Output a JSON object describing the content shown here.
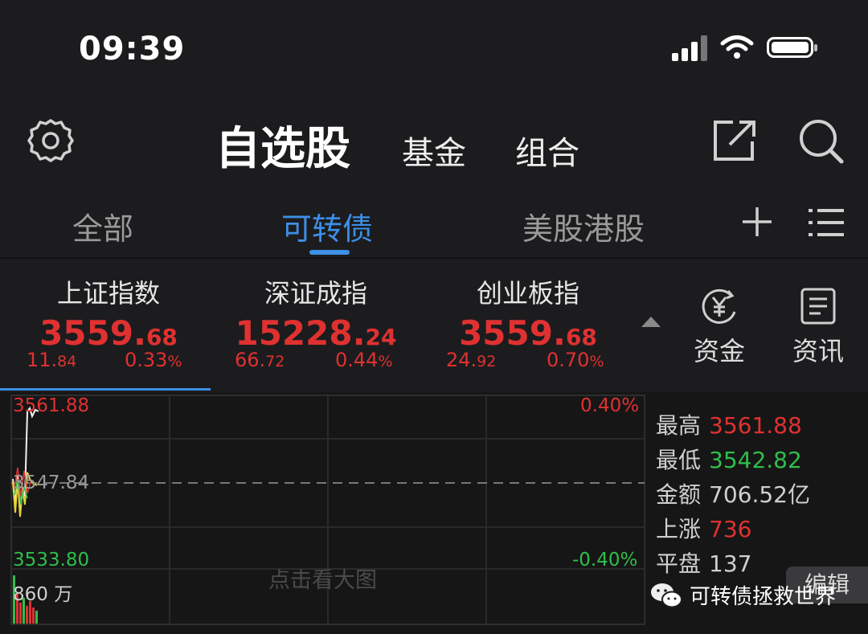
{
  "status_bar": {
    "time": "09:39"
  },
  "header": {
    "title": "自选股",
    "tabs": [
      "基金",
      "组合"
    ]
  },
  "subtabs": {
    "items": [
      "全部",
      "可转债",
      "美股港股"
    ],
    "active_index": 1
  },
  "indices": [
    {
      "name": "上证指数",
      "value_int": "3559.",
      "value_dec": "68",
      "change_int": "11.",
      "change_dec": "84",
      "pct_int": "0.33",
      "pct_unit": "%"
    },
    {
      "name": "深证成指",
      "value_int": "15228.",
      "value_dec": "24",
      "change_int": "66.",
      "change_dec": "72",
      "pct_int": "0.44",
      "pct_unit": "%"
    },
    {
      "name": "创业板指",
      "value_int": "3559.",
      "value_dec": "68",
      "change_int": "24.",
      "change_dec": "92",
      "pct_int": "0.70",
      "pct_unit": "%"
    }
  ],
  "side_buttons": {
    "funds": "资金",
    "news": "资讯"
  },
  "chart": {
    "high_label": "3561.88",
    "mid_label": "3547.84",
    "low_label": "3533.80",
    "pct_top": "0.40%",
    "pct_bottom": "-0.40%",
    "volume_label": "860 万",
    "hint": "点击看大图"
  },
  "stats": [
    {
      "key": "最高",
      "value": "3561.88",
      "color": "#e03131"
    },
    {
      "key": "最低",
      "value": "3542.82",
      "color": "#2fbf4a"
    },
    {
      "key": "金额",
      "value": "706.52亿",
      "color": "#cfcfcf"
    },
    {
      "key": "上涨",
      "value": "736",
      "color": "#e03131"
    },
    {
      "key": "平盘",
      "value": "137",
      "color": "#cfcfcf"
    }
  ],
  "edit_button": "编辑",
  "watermark": "可转债拯救世界",
  "colors": {
    "up": "#e03131",
    "down": "#2fbf4a",
    "accent": "#3d8fe8"
  }
}
